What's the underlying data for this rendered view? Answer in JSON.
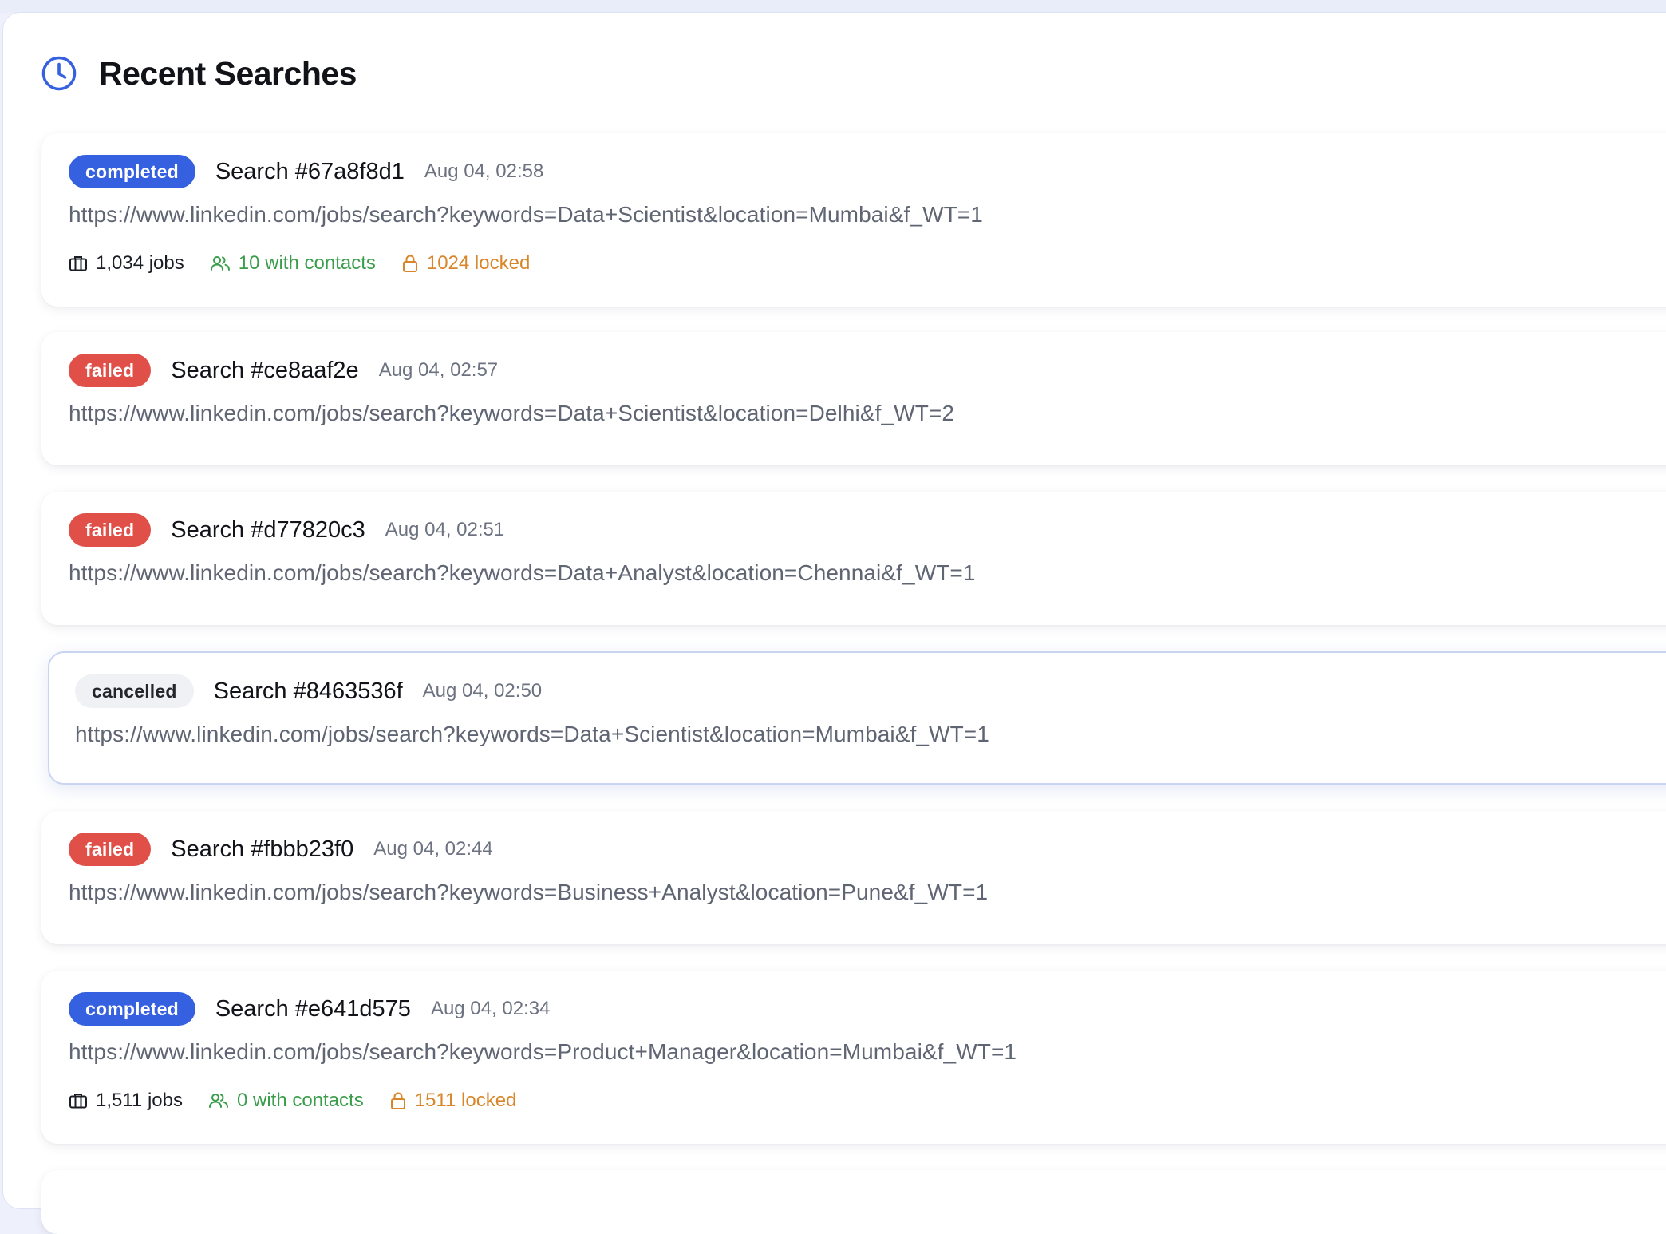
{
  "header": {
    "title": "Recent Searches"
  },
  "colors": {
    "accent": "#3560e0",
    "failed": "#e05048",
    "contacts": "#3a9d4a",
    "locked": "#d9862a"
  },
  "searches": [
    {
      "status": "completed",
      "title": "Search #67a8f8d1",
      "time": "Aug 04, 02:58",
      "url": "https://www.linkedin.com/jobs/search?keywords=Data+Scientist&location=Mumbai&f_WT=1",
      "jobs": "1,034 jobs",
      "contacts": "10 with contacts",
      "locked": "1024 locked"
    },
    {
      "status": "failed",
      "title": "Search #ce8aaf2e",
      "time": "Aug 04, 02:57",
      "url": "https://www.linkedin.com/jobs/search?keywords=Data+Scientist&location=Delhi&f_WT=2"
    },
    {
      "status": "failed",
      "title": "Search #d77820c3",
      "time": "Aug 04, 02:51",
      "url": "https://www.linkedin.com/jobs/search?keywords=Data+Analyst&location=Chennai&f_WT=1"
    },
    {
      "status": "cancelled",
      "title": "Search #8463536f",
      "time": "Aug 04, 02:50",
      "url": "https://www.linkedin.com/jobs/search?keywords=Data+Scientist&location=Mumbai&f_WT=1"
    },
    {
      "status": "failed",
      "title": "Search #fbbb23f0",
      "time": "Aug 04, 02:44",
      "url": "https://www.linkedin.com/jobs/search?keywords=Business+Analyst&location=Pune&f_WT=1"
    },
    {
      "status": "completed",
      "title": "Search #e641d575",
      "time": "Aug 04, 02:34",
      "url": "https://www.linkedin.com/jobs/search?keywords=Product+Manager&location=Mumbai&f_WT=1",
      "jobs": "1,511 jobs",
      "contacts": "0 with contacts",
      "locked": "1511 locked"
    }
  ]
}
